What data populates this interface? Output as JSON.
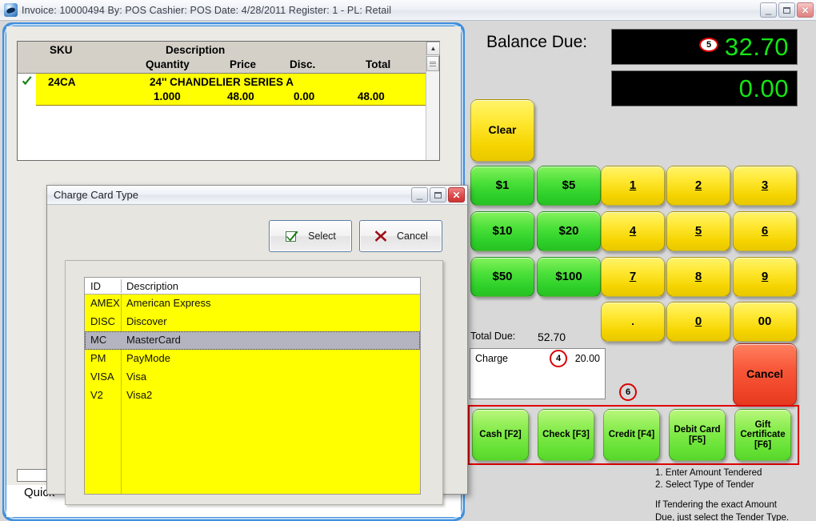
{
  "window": {
    "title": "Invoice: 10000494  By: POS  Cashier: POS   Date: 4/28/2011  Register: 1 - PL: Retail",
    "minimize": "_",
    "maximize": "□",
    "close": "×"
  },
  "invoice_grid": {
    "headers_row1": {
      "sku": "SKU",
      "description": "Description"
    },
    "headers_row2": {
      "quantity": "Quantity",
      "price": "Price",
      "disc": "Disc.",
      "total": "Total"
    },
    "rows": [
      {
        "selected": true,
        "sku": "24CA",
        "description": "24'' CHANDELIER SERIES A",
        "quantity": "1.000",
        "price": "48.00",
        "disc": "0.00",
        "total": "48.00"
      }
    ],
    "quick_label": "Quick"
  },
  "pos": {
    "balance_due_label": "Balance Due:",
    "balance_due_value": "32.70",
    "secondary_value": "0.00",
    "clear_label": "Clear",
    "cash_buttons": [
      "$1",
      "$5",
      "$10",
      "$20",
      "$50",
      "$100"
    ],
    "numpad": [
      "1",
      "2",
      "3",
      "4",
      "5",
      "6",
      "7",
      "8",
      "9",
      ".",
      "0",
      "00"
    ],
    "total_due_label": "Total Due:",
    "total_due_value": "52.70",
    "charge_entry": {
      "label": "Charge",
      "value": "20.00"
    },
    "cancel_label": "Cancel",
    "tender_buttons": [
      "Cash [F2]",
      "Check [F3]",
      "Credit [F4]",
      "Debit Card [F5]",
      "Gift Certificate [F6]"
    ],
    "instructions": [
      "1. Enter Amount Tendered",
      "2. Select Type of Tender",
      "If Tendering the exact Amount",
      "Due, just select the Tender Type."
    ],
    "annotations": [
      {
        "id": "4",
        "target": "charge-entry"
      },
      {
        "id": "5",
        "target": "balance-due"
      },
      {
        "id": "6",
        "target": "tender-row"
      }
    ]
  },
  "dialog": {
    "title": "Charge Card Type",
    "minimize": "_",
    "maximize": "□",
    "close": "×",
    "select_label": "Select",
    "cancel_label": "Cancel",
    "list": {
      "headers": {
        "id": "ID",
        "description": "Description"
      },
      "rows": [
        {
          "id": "AMEX",
          "description": "American Express",
          "selected": false
        },
        {
          "id": "DISC",
          "description": "Discover",
          "selected": false
        },
        {
          "id": "MC",
          "description": "MasterCard",
          "selected": true
        },
        {
          "id": "PM",
          "description": "PayMode",
          "selected": false
        },
        {
          "id": "VISA",
          "description": "Visa",
          "selected": false
        },
        {
          "id": "V2",
          "description": "Visa2",
          "selected": false
        }
      ]
    }
  },
  "colors": {
    "lcd_green": "#15e515",
    "highlight_yellow": "#ffff00",
    "annotation_red": "#d90000",
    "frame_blue": "#3f8fdd"
  }
}
